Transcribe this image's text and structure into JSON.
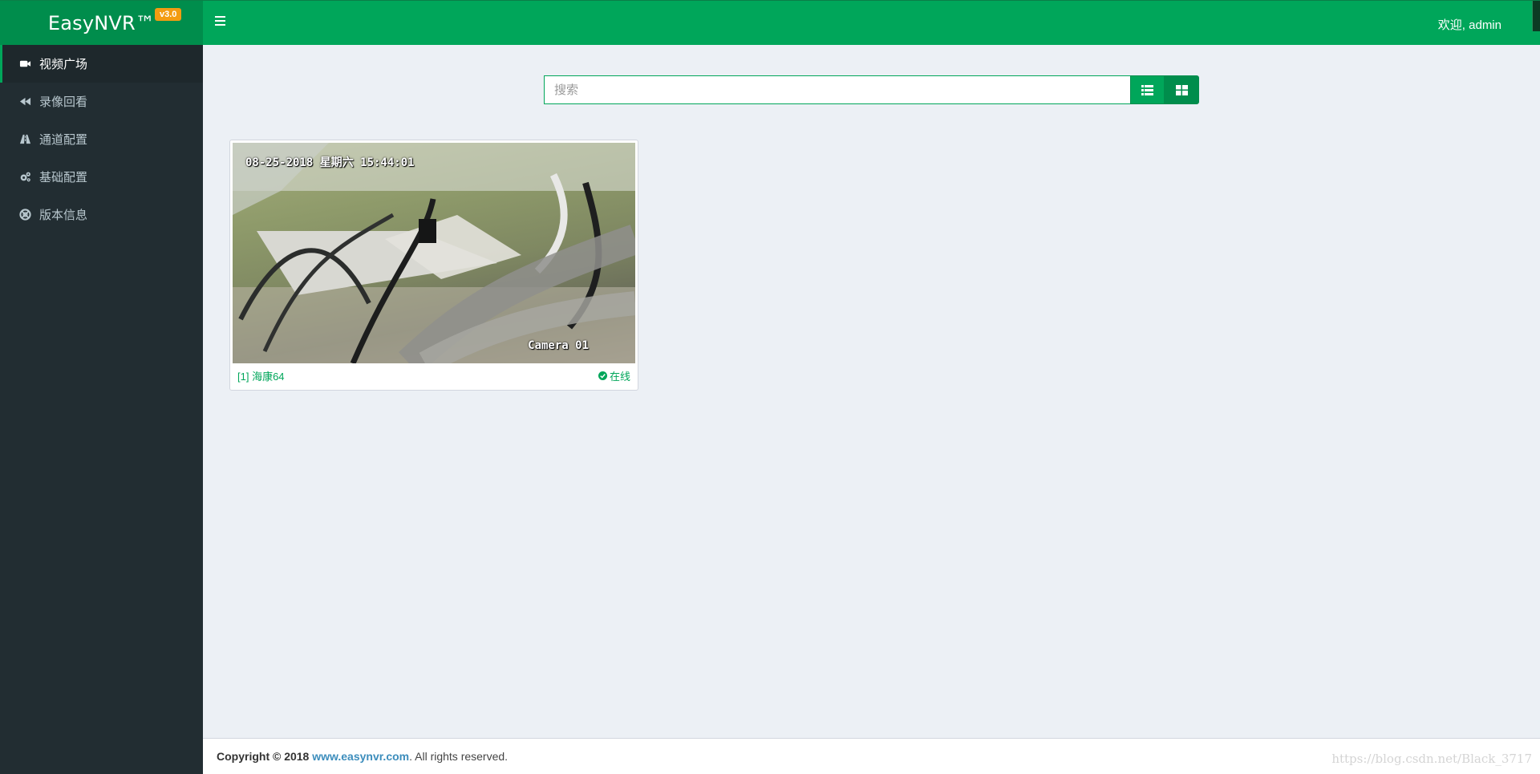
{
  "header": {
    "logo": "EasyNVR™",
    "version": "v3.0",
    "user_text": "欢迎, admin"
  },
  "sidebar": {
    "items": [
      {
        "label": "视频广场",
        "icon": "video-camera-icon"
      },
      {
        "label": "录像回看",
        "icon": "backward-icon"
      },
      {
        "label": "通道配置",
        "icon": "road-icon"
      },
      {
        "label": "基础配置",
        "icon": "cogs-icon"
      },
      {
        "label": "版本信息",
        "icon": "life-ring-icon"
      }
    ]
  },
  "search": {
    "placeholder": "搜索",
    "value": ""
  },
  "camera": {
    "osd_datetime": "08-25-2018 星期六 15:44:01",
    "osd_name": "Camera 01",
    "title": "[1] 海康64",
    "status": "在线"
  },
  "footer": {
    "copyright": "Copyright © 2018",
    "link_text": "www.easynvr.com",
    "suffix": ". All rights reserved."
  },
  "watermark": "https://blog.csdn.net/Black_3717",
  "colors": {
    "header": "#00a65a",
    "logo_bg": "#008d4c",
    "sidebar": "#222d32",
    "badge": "#f39c12",
    "content_bg": "#ecf0f5"
  }
}
